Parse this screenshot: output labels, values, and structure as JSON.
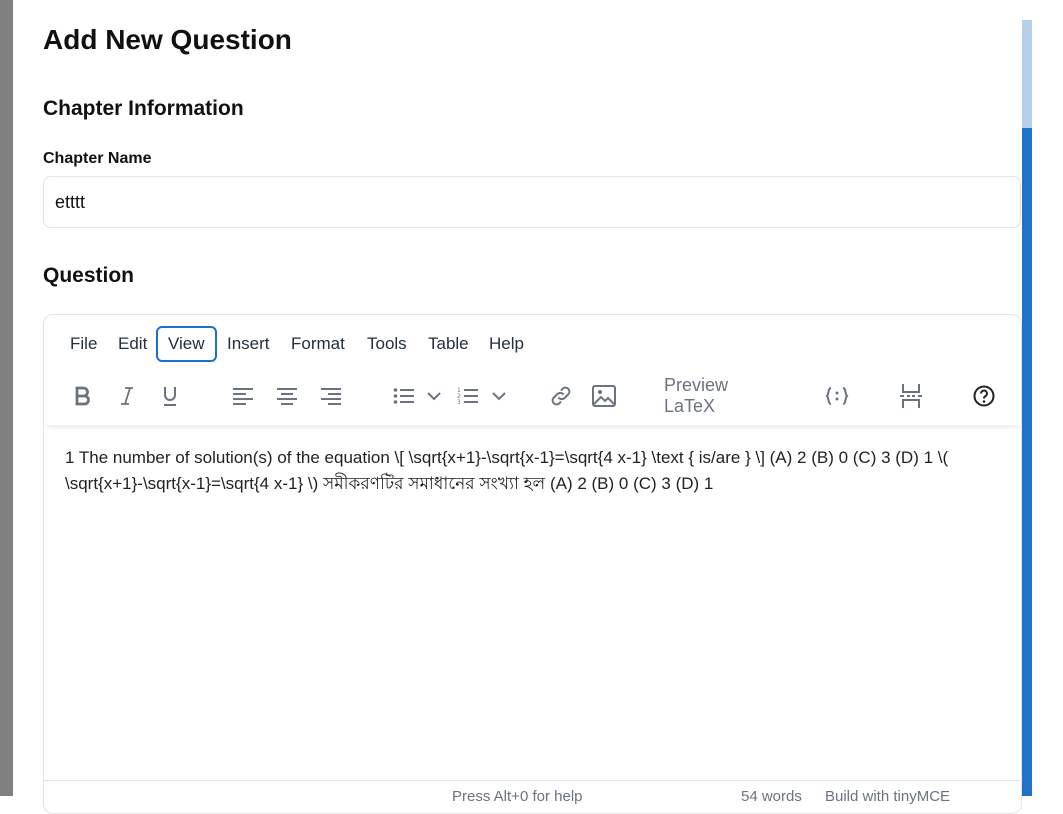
{
  "page": {
    "title": "Add New Question",
    "chapter_section_title": "Chapter Information",
    "chapter_name_label": "Chapter Name",
    "chapter_name_value": "etttt",
    "question_section_title": "Question"
  },
  "editor": {
    "menu": [
      {
        "label": "File",
        "active": false
      },
      {
        "label": "Edit",
        "active": false
      },
      {
        "label": "View",
        "active": true
      },
      {
        "label": "Insert",
        "active": false
      },
      {
        "label": "Format",
        "active": false
      },
      {
        "label": "Tools",
        "active": false
      },
      {
        "label": "Table",
        "active": false
      },
      {
        "label": "Help",
        "active": false
      }
    ],
    "toolbar": {
      "icons": [
        "bold-icon",
        "italic-icon",
        "underline-icon",
        "align-left-icon",
        "align-center-icon",
        "align-right-icon",
        "bullet-list-icon",
        "chevron-down-icon",
        "numbered-list-icon",
        "chevron-down-icon",
        "link-icon",
        "image-icon",
        "code-sample-icon",
        "page-break-icon",
        "help-icon"
      ],
      "preview_latex_label": "Preview LaTeX"
    },
    "content": "1 The number of solution(s) of the equation \\[ \\sqrt{x+1}-\\sqrt{x-1}=\\sqrt{4 x-1} \\text { is/are } \\] (A) 2 (B) 0 (C) 3 (D) 1 \\( \\sqrt{x+1}-\\sqrt{x-1}=\\sqrt{4 x-1} \\) সমীকরণটির সমাধানের সংখ্যা হল (A) 2 (B) 0 (C) 3 (D) 1",
    "status": {
      "hint": "Press Alt+0 for help",
      "word_count": "54 words",
      "brand": "Build with tinyMCE"
    }
  },
  "colors": {
    "accent": "#1e6ed2",
    "scrollbar": "#1e73c8",
    "icon": "#6b7280"
  }
}
